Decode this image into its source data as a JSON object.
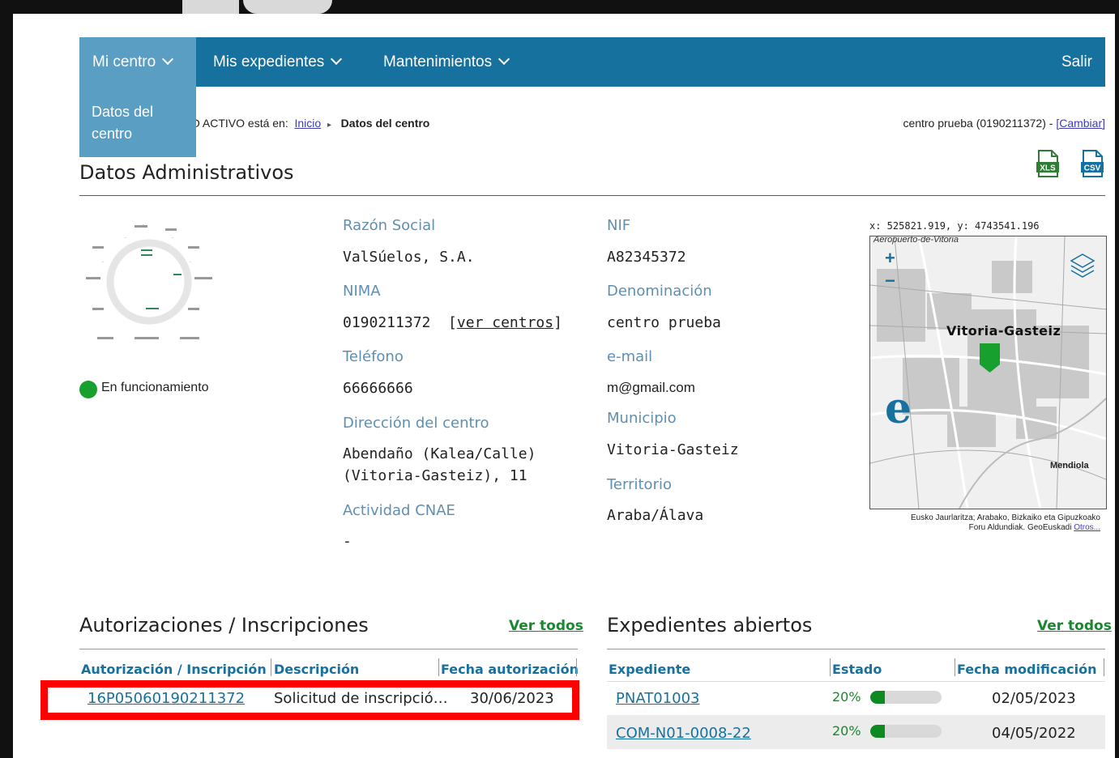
{
  "nav": {
    "items": [
      {
        "label": "Mi centro",
        "active": true
      },
      {
        "label": "Mis expedientes",
        "active": false
      },
      {
        "label": "Mantenimientos",
        "active": false
      }
    ],
    "logout": "Salir",
    "dropdown": {
      "item": "Datos del centro"
    }
  },
  "breadcrumb": {
    "prefix": "IO ACTIVO está en:",
    "home": "Inicio",
    "current": "Datos del centro"
  },
  "centro": {
    "name": "centro prueba (0190211372) - ",
    "change": "[Cambiar]"
  },
  "datos": {
    "title": "Datos Administrativos",
    "export": {
      "xls": "XLS",
      "csv": "CSV"
    },
    "status": "En funcionamiento",
    "razon_social": {
      "label": "Razón Social",
      "value": "ValSúelos, S.A."
    },
    "nima": {
      "label": "NIMA",
      "value": "0190211372",
      "link": "ver centros"
    },
    "telefono": {
      "label": "Teléfono",
      "value": "66666666"
    },
    "direccion": {
      "label": "Dirección del centro",
      "line1": "Abendaño (Kalea/Calle)",
      "line2": "(Vitoria-Gasteiz), 11"
    },
    "cnae": {
      "label": "Actividad CNAE",
      "value": "-"
    },
    "nif": {
      "label": "NIF",
      "value": "A82345372"
    },
    "denominacion": {
      "label": "Denominación",
      "value": "centro prueba"
    },
    "email": {
      "label": "e-mail",
      "value": "m@gmail.com"
    },
    "municipio": {
      "label": "Municipio",
      "value": "Vitoria-Gasteiz"
    },
    "territorio": {
      "label": "Territorio",
      "value": "Araba/Álava"
    }
  },
  "map": {
    "coords": "x: 525821.919, y: 4743541.196",
    "airport_label": "Aeropuerto-de-Vitoria",
    "city_label": "Vitoria-Gasteiz",
    "district_label": "Mendiola",
    "zoom_in": "+",
    "zoom_out": "−",
    "credits1": "Eusko Jaurlaritza; Arabako, Bizkaiko eta Gipuzkoako",
    "credits2": "Foru Aldundiak. GeoEuskadi ",
    "credits_link": "Otros..."
  },
  "autorizaciones": {
    "title": "Autorizaciones / Inscripciones",
    "ver_todos": "Ver todos",
    "columns": [
      "Autorización / Inscripción",
      "Descripción",
      "Fecha autorización"
    ],
    "rows": [
      {
        "id": "16P05060190211372",
        "descripcion": "Solicitud de inscripció…",
        "fecha": "30/06/2023"
      }
    ]
  },
  "expedientes": {
    "title": "Expedientes abiertos",
    "ver_todos": "Ver todos",
    "columns": [
      "Expediente",
      "Estado",
      "Fecha modificación"
    ],
    "rows": [
      {
        "id": "PNAT01003",
        "estado": "20%",
        "progress": 0.2,
        "fecha": "02/05/2023"
      },
      {
        "id": "COM-N01-0008-22",
        "estado": "20%",
        "progress": 0.2,
        "fecha": "04/05/2022"
      }
    ]
  },
  "colors": {
    "primary": "#17719f",
    "nav_active": "#5a9ec4",
    "label": "#5f8fb1",
    "green": "#17882e",
    "highlight": "#ff0000"
  }
}
